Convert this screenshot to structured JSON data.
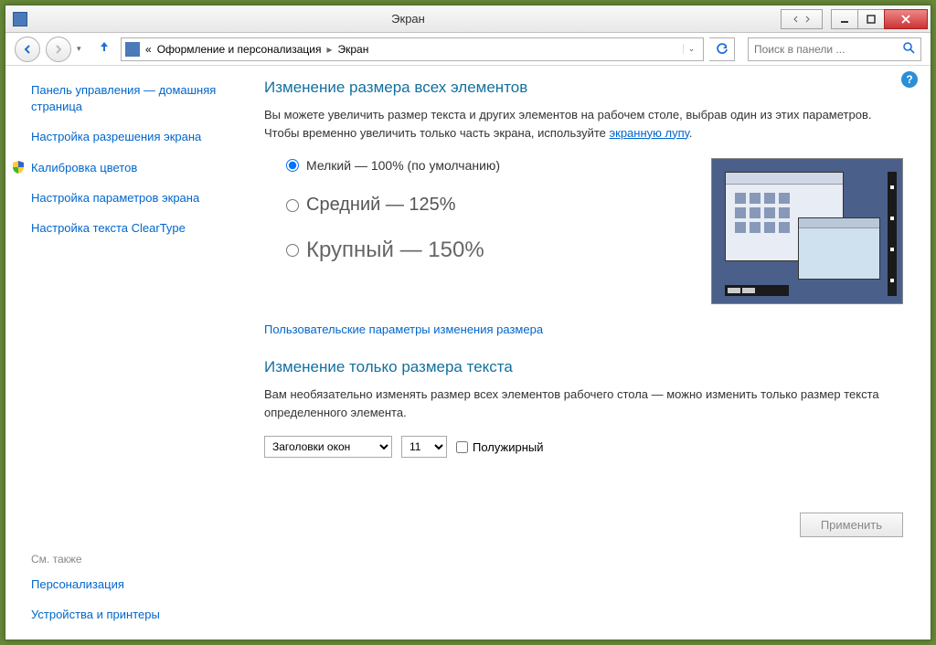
{
  "window": {
    "title": "Экран"
  },
  "breadcrumb": {
    "prefix": "«",
    "part1": "Оформление и персонализация",
    "part2": "Экран"
  },
  "search": {
    "placeholder": "Поиск в панели ..."
  },
  "sidebar": {
    "home": "Панель управления — домашняя страница",
    "links": [
      "Настройка разрешения экрана",
      "Калибровка цветов",
      "Настройка параметров экрана",
      "Настройка текста ClearType"
    ],
    "see_also_label": "См. также",
    "see_also": [
      "Персонализация",
      "Устройства и принтеры"
    ]
  },
  "main": {
    "heading1": "Изменение размера всех элементов",
    "desc1a": "Вы можете увеличить размер текста и других элементов на рабочем столе, выбрав один из этих параметров. Чтобы временно увеличить только часть экрана, используйте ",
    "desc1link": "экранную лупу",
    "desc1b": ".",
    "radios": [
      {
        "label": "Мелкий — 100% (по умолчанию)"
      },
      {
        "label": "Средний — 125%"
      },
      {
        "label": "Крупный — 150%"
      }
    ],
    "custom_link": "Пользовательские параметры изменения размера",
    "heading2": "Изменение только размера текста",
    "desc2": "Вам необязательно изменять размер всех элементов рабочего стола — можно изменить только размер текста определенного элемента.",
    "element_select": "Заголовки окон",
    "size_select": "11",
    "bold_label": "Полужирный",
    "apply": "Применить"
  }
}
